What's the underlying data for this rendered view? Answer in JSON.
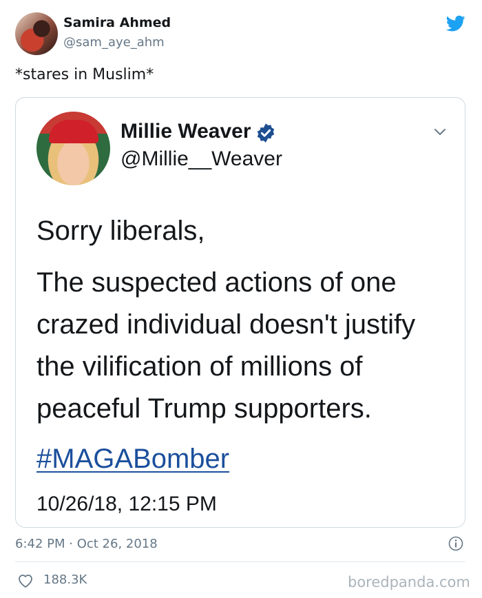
{
  "tweet": {
    "author_name": "Samira Ahmed",
    "author_handle": "@sam_aye_ahm",
    "text": "*stares in Muslim*",
    "timestamp": "6:42 PM · Oct 26, 2018",
    "likes": "188.3K"
  },
  "quoted": {
    "author_name": "Millie Weaver",
    "author_handle": "@Millie__Weaver",
    "lines": [
      "Sorry liberals,",
      "The suspected actions of one",
      "crazed individual doesn't justify",
      "the vilification of millions of",
      "peaceful Trump supporters."
    ],
    "hashtag": "#MAGABomber",
    "date": "10/26/18, 12:15 PM"
  },
  "watermark": "boredpanda.com",
  "colors": {
    "twitter_blue": "#1da1f2",
    "hashtag_blue": "#1b4f9c",
    "muted": "#657786"
  },
  "icons": {
    "brand": "twitter-bird-icon",
    "verified": "verified-badge-icon",
    "menu": "chevron-down-icon",
    "info": "info-icon",
    "like": "heart-icon"
  }
}
